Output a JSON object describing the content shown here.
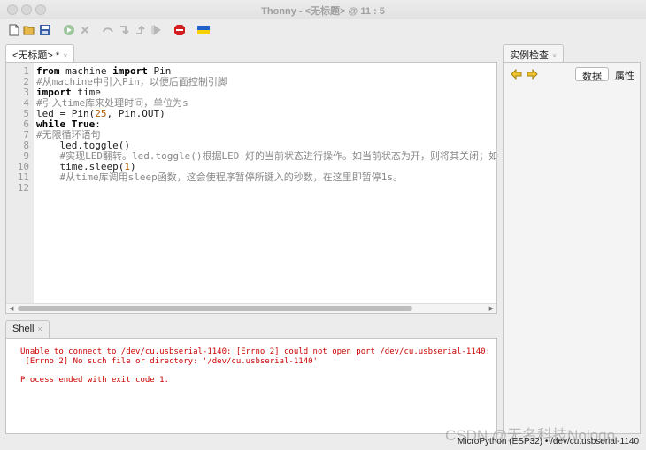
{
  "window": {
    "title": "Thonny  -  <无标题>  @  11 : 5"
  },
  "toolbar": {
    "icons": [
      "new-file-icon",
      "open-file-icon",
      "save-icon",
      "run-icon",
      "debug-icon",
      "step-over-icon",
      "step-into-icon",
      "step-out-icon",
      "resume-icon",
      "stop-icon",
      "ukraine-flag-icon"
    ]
  },
  "editor": {
    "tab_label": "<无标题> *",
    "tab_close": "×",
    "line_numbers": [
      "1",
      "2",
      "3",
      "4",
      "5",
      "6",
      "7",
      "8",
      "9",
      "10",
      "11",
      "12"
    ],
    "lines": [
      [
        {
          "t": "kw",
          "s": "from"
        },
        {
          "t": "n",
          "s": " machine "
        },
        {
          "t": "kw",
          "s": "import"
        },
        {
          "t": "n",
          "s": " Pin"
        }
      ],
      [
        {
          "t": "cm",
          "s": "#从machine中引入Pin，以便后面控制引脚"
        }
      ],
      [
        {
          "t": "kw",
          "s": "import"
        },
        {
          "t": "n",
          "s": " time"
        }
      ],
      [
        {
          "t": "cm",
          "s": "#引入time库来处理时间，单位为s"
        }
      ],
      [
        {
          "t": "n",
          "s": "led = Pin("
        },
        {
          "t": "num",
          "s": "25"
        },
        {
          "t": "n",
          "s": ", Pin.OUT)"
        }
      ],
      [
        {
          "t": "kw",
          "s": "while"
        },
        {
          "t": "n",
          "s": " "
        },
        {
          "t": "kw",
          "s": "True"
        },
        {
          "t": "n",
          "s": ":"
        }
      ],
      [
        {
          "t": "cm",
          "s": "#无限循环语句"
        }
      ],
      [
        {
          "t": "n",
          "s": "    led.toggle()"
        }
      ],
      [
        {
          "t": "n",
          "s": "    "
        },
        {
          "t": "cm",
          "s": "#实现LED翻转。led.toggle()根据LED 灯的当前状态进行操作。如当前状态为开，则将其关闭；如当前状"
        }
      ],
      [
        {
          "t": "n",
          "s": "    time.sleep("
        },
        {
          "t": "num",
          "s": "1"
        },
        {
          "t": "n",
          "s": ")"
        }
      ],
      [
        {
          "t": "n",
          "s": "    "
        },
        {
          "t": "cm",
          "s": "#从time库调用sleep函数，这会使程序暂停所键入的秒数，在这里即暂停1s。"
        }
      ],
      [
        {
          "t": "n",
          "s": ""
        }
      ]
    ]
  },
  "shell": {
    "tab_label": "Shell",
    "tab_close": "×",
    "output": [
      "Unable to connect to /dev/cu.usbserial-1140: [Errno 2] could not open port /dev/cu.usbserial-1140:",
      " [Errno 2] No such file or directory: '/dev/cu.usbserial-1140'",
      "",
      "Process ended with exit code 1."
    ]
  },
  "inspector": {
    "tab_label": "实例检查",
    "tab_close": "×",
    "data_button": "数据",
    "attr_button": "属性"
  },
  "status": {
    "interpreter": "MicroPython (ESP32)  •  /dev/cu.usbserial-1140"
  },
  "watermark": "CSDN @无名科技Nologo",
  "colors": {
    "error": "#cc0000",
    "comment": "#888888",
    "number": "#b05a00"
  }
}
